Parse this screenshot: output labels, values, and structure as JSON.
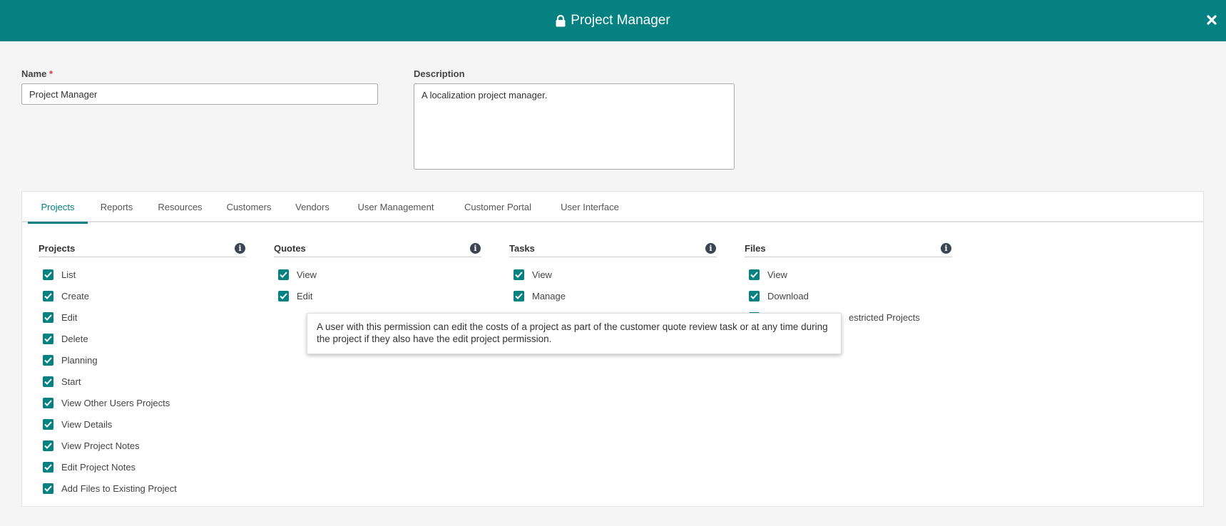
{
  "header": {
    "title": "Project Manager",
    "brand_color": "#058181"
  },
  "form": {
    "name_label": "Name",
    "required_mark": "*",
    "name_value": "Project Manager",
    "description_label": "Description",
    "description_value": "A localization project manager."
  },
  "tabs": [
    {
      "label": "Projects",
      "active": true
    },
    {
      "label": "Reports"
    },
    {
      "label": "Resources"
    },
    {
      "label": "Customers"
    },
    {
      "label": "Vendors"
    },
    {
      "label": "User Management"
    },
    {
      "label": "Customer Portal"
    },
    {
      "label": "User Interface"
    }
  ],
  "permissions": {
    "projects": {
      "title": "Projects",
      "items": [
        "List",
        "Create",
        "Edit",
        "Delete",
        "Planning",
        "Start",
        "View Other Users Projects",
        "View Details",
        "View Project Notes",
        "Edit Project Notes",
        "Add Files to Existing Project"
      ]
    },
    "quotes": {
      "title": "Quotes",
      "items": [
        "View",
        "Edit"
      ]
    },
    "tasks": {
      "title": "Tasks",
      "items": [
        "View",
        "Manage"
      ]
    },
    "files": {
      "title": "Files",
      "items": [
        "View",
        "Download"
      ],
      "partially_hidden_item": "estricted Projects"
    }
  },
  "tooltip": {
    "text": "A user with this permission can edit the costs of a project as part of the customer quote review task or at any time during the project if they also have the edit project permission."
  }
}
